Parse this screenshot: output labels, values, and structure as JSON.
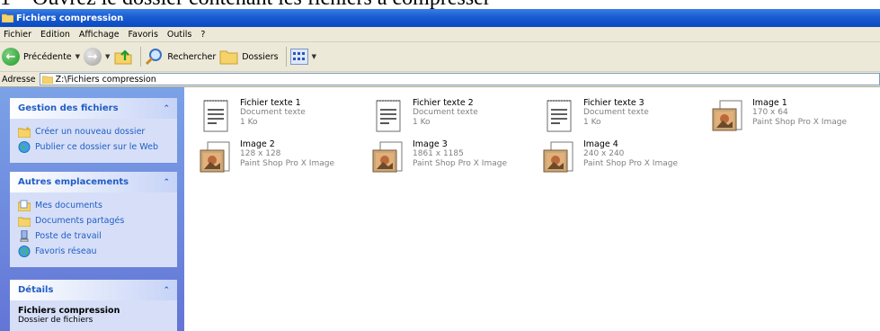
{
  "caption": "1 – Ouvrez le dossier contenant les fichiers à compresser",
  "window": {
    "title": "Fichiers compression"
  },
  "menu": [
    "Fichier",
    "Edition",
    "Affichage",
    "Favoris",
    "Outils",
    "?"
  ],
  "toolbar": {
    "back_label": "Précédente",
    "search_label": "Rechercher",
    "folders_label": "Dossiers"
  },
  "address": {
    "label": "Adresse",
    "value": "Z:\\Fichiers compression"
  },
  "panels": {
    "tasks": {
      "title": "Gestion des fichiers",
      "items": [
        "Créer un nouveau dossier",
        "Publier ce dossier sur le Web"
      ]
    },
    "places": {
      "title": "Autres emplacements",
      "items": [
        "Mes documents",
        "Documents partagés",
        "Poste de travail",
        "Favoris réseau"
      ]
    },
    "details": {
      "title": "Détails",
      "name": "Fichiers compression",
      "type": "Dossier de fichiers"
    }
  },
  "files": [
    {
      "name": "Fichier texte 1",
      "line1": "Document texte",
      "line2": "1 Ko",
      "icon": "text-file-icon"
    },
    {
      "name": "Fichier texte 2",
      "line1": "Document texte",
      "line2": "1 Ko",
      "icon": "text-file-icon"
    },
    {
      "name": "Fichier texte 3",
      "line1": "Document texte",
      "line2": "1 Ko",
      "icon": "text-file-icon"
    },
    {
      "name": "Image 1",
      "line1": "170 x 64",
      "line2": "Paint Shop Pro X Image",
      "icon": "image-file-icon"
    },
    {
      "name": "Image 2",
      "line1": "128 x 128",
      "line2": "Paint Shop Pro X Image",
      "icon": "image-file-icon"
    },
    {
      "name": "Image 3",
      "line1": "1861 x 1185",
      "line2": "Paint Shop Pro X Image",
      "icon": "image-file-icon"
    },
    {
      "name": "Image 4",
      "line1": "240 x 240",
      "line2": "Paint Shop Pro X Image",
      "icon": "image-file-icon"
    }
  ]
}
